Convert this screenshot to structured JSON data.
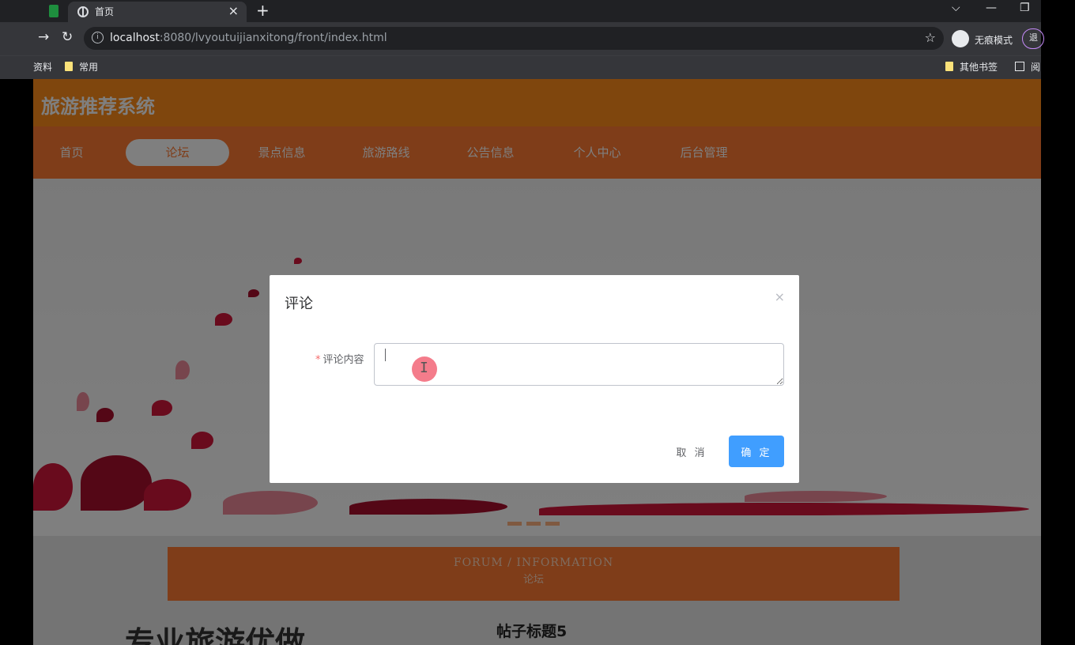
{
  "browser": {
    "tab_title": "首页",
    "tab_close": "×",
    "new_tab": "+",
    "url_host": "localhost",
    "url_rest": ":8080/lvyoutuijianxitong/front/index.html",
    "incognito_label": "无痕模式",
    "ext_label": "退",
    "bookmarks": {
      "left_cut": "资料",
      "folder1": "常用",
      "other": "其他书签",
      "reader": "阅"
    }
  },
  "site": {
    "title": "旅游推荐系统",
    "nav": [
      {
        "label": "首页"
      },
      {
        "label": "论坛",
        "active": true
      },
      {
        "label": "景点信息"
      },
      {
        "label": "旅游路线"
      },
      {
        "label": "公告信息"
      },
      {
        "label": "个人中心"
      },
      {
        "label": "后台管理"
      }
    ],
    "section_en": "FORUM / INFORMATION",
    "section_cn": "论坛",
    "slogan": "专业旅游优做",
    "post_title": "帖子标题5"
  },
  "dialog": {
    "title": "评论",
    "close": "×",
    "field_label": "评论内容",
    "required_mark": "*",
    "input_value": "",
    "cancel_label": "取 消",
    "confirm_label": "确 定"
  },
  "colors": {
    "header": "#ff8c1a",
    "nav": "#ff7a33",
    "primary_button": "#409eff"
  }
}
